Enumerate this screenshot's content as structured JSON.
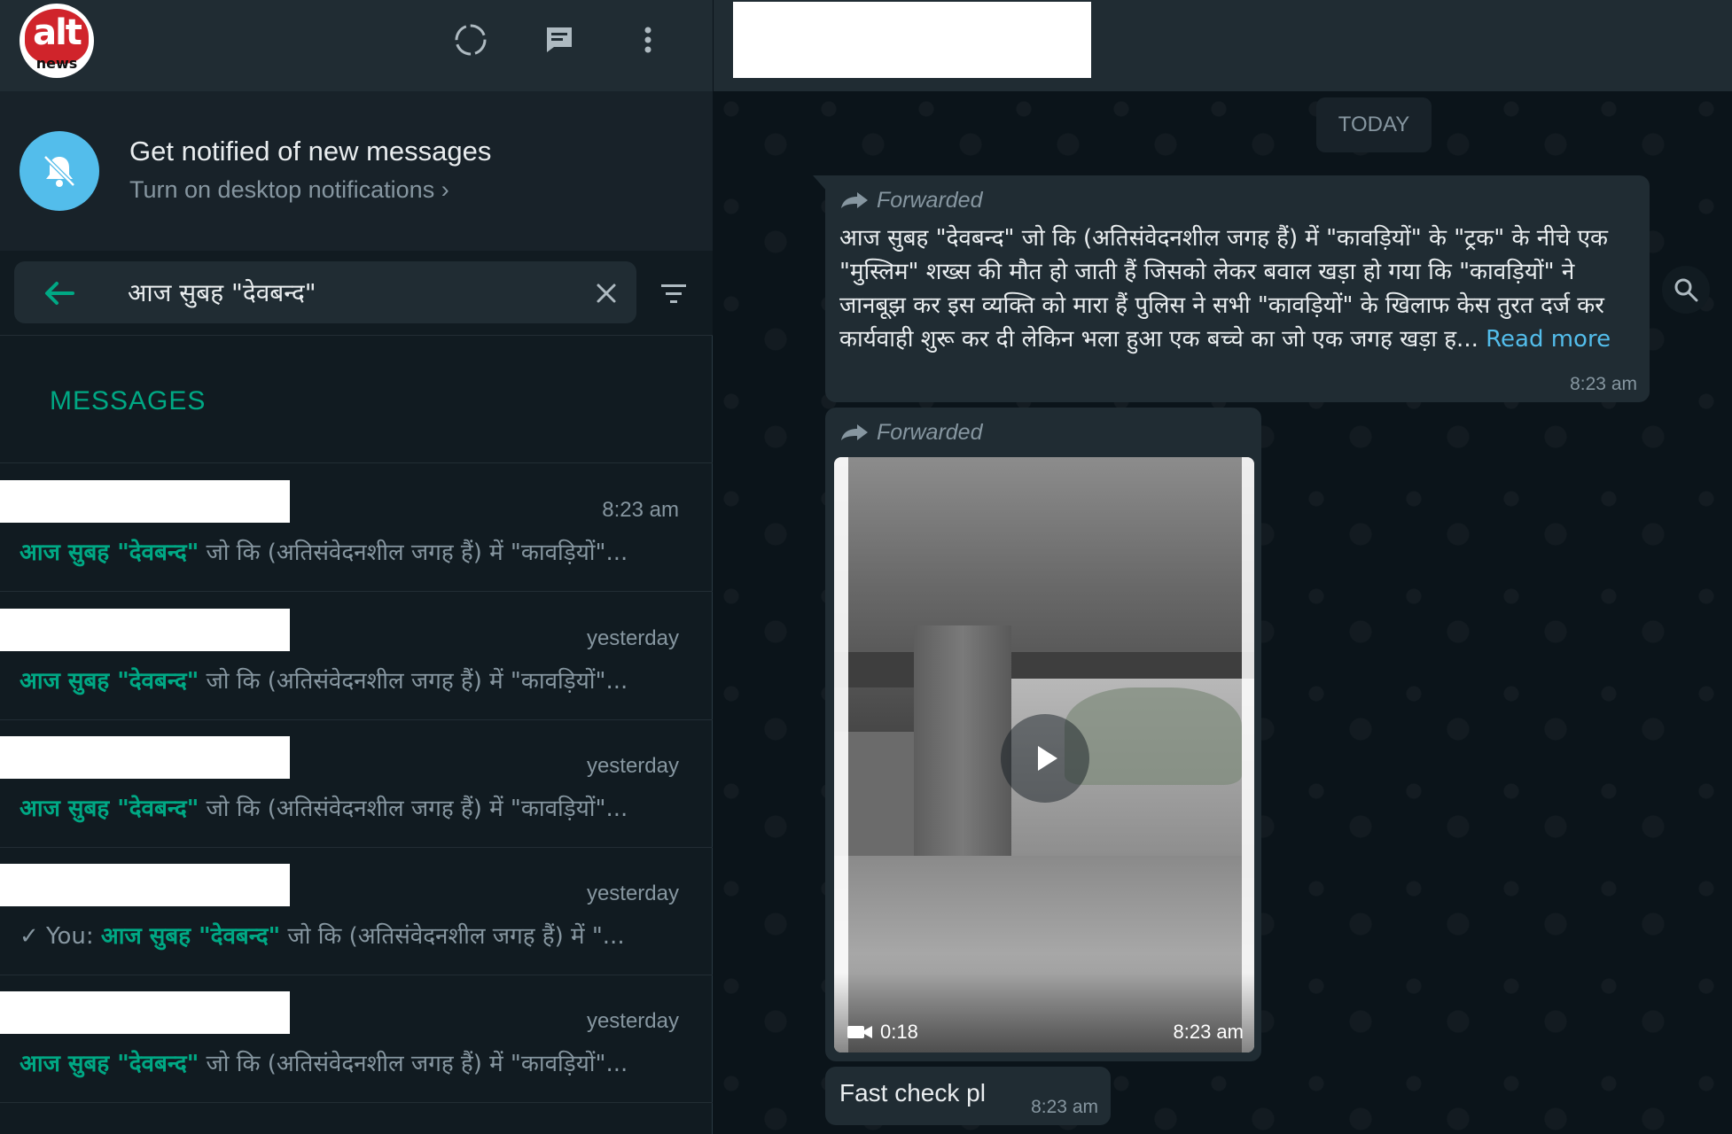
{
  "colors": {
    "accent": "#00a884",
    "link": "#53bdeb",
    "panel_bg": "#111b21",
    "header_bg": "#202c33",
    "bubble_bg": "#202c33"
  },
  "left_header": {
    "avatar_logo": "alt news",
    "avatar_logo_top": "alt",
    "avatar_logo_bottom": "news",
    "icons": [
      "status-icon",
      "new-chat-icon",
      "menu-icon"
    ]
  },
  "notification_banner": {
    "title": "Get notified of new messages",
    "subtitle": "Turn on desktop notifications ›",
    "icon": "bell-off-icon"
  },
  "search": {
    "value": "आज सुबह \"देवबन्द\"",
    "back_icon": "back-arrow-icon",
    "clear_icon": "close-icon",
    "filter_icon": "filter-icon"
  },
  "messages_section": {
    "label": "MESSAGES"
  },
  "results": [
    {
      "time": "8:23 am",
      "prefix": "",
      "match": "आज सुबह \"देवबन्द\"",
      "rest": " जो कि (अतिसंवेदनशील जगह हैं) में \"कावड़ियों\"..."
    },
    {
      "time": "yesterday",
      "prefix": "",
      "match": "आज सुबह \"देवबन्द\"",
      "rest": " जो कि (अतिसंवेदनशील जगह हैं) में \"कावड़ियों\"..."
    },
    {
      "time": "yesterday",
      "prefix": "",
      "match": "आज सुबह \"देवबन्द\"",
      "rest": " जो कि (अतिसंवेदनशील जगह हैं) में \"कावड़ियों\"..."
    },
    {
      "time": "yesterday",
      "prefix": "✓ You: ",
      "match": "आज सुबह \"देवबन्द\"",
      "rest": " जो कि (अतिसंवेदनशील जगह हैं) में \"..."
    },
    {
      "time": "yesterday",
      "prefix": "",
      "match": "आज सुबह \"देवबन्द\"",
      "rest": " जो कि (अतिसंवेदनशील जगह हैं) में \"कावड़ियों\"..."
    }
  ],
  "chat": {
    "date_chip": "TODAY",
    "message1": {
      "forwarded_label": "Forwarded",
      "text": "आज सुबह \"देवबन्द\" जो कि (अतिसंवेदनशील जगह हैं) में \"कावड़ियों\" के \"ट्रक\" के नीचे एक \"मुस्लिम\" शख्स की मौत हो जाती हैं  जिसको लेकर बवाल खड़ा हो गया कि \"कावड़ियों\" ने जानबूझ कर इस व्यक्ति को मारा हैं पुलिस ने सभी \"कावड़ियों\" के खिलाफ केस तुरत दर्ज कर कार्यवाही शुरू कर दी  लेकिन भला हुआ एक बच्चे का जो एक जगह खड़ा ह... ",
      "read_more": "Read more",
      "time": "8:23 am"
    },
    "message2": {
      "forwarded_label": "Forwarded",
      "video_duration": "0:18",
      "time": "8:23 am"
    },
    "message3": {
      "text": "Fast check pl",
      "time": "8:23 am"
    }
  }
}
